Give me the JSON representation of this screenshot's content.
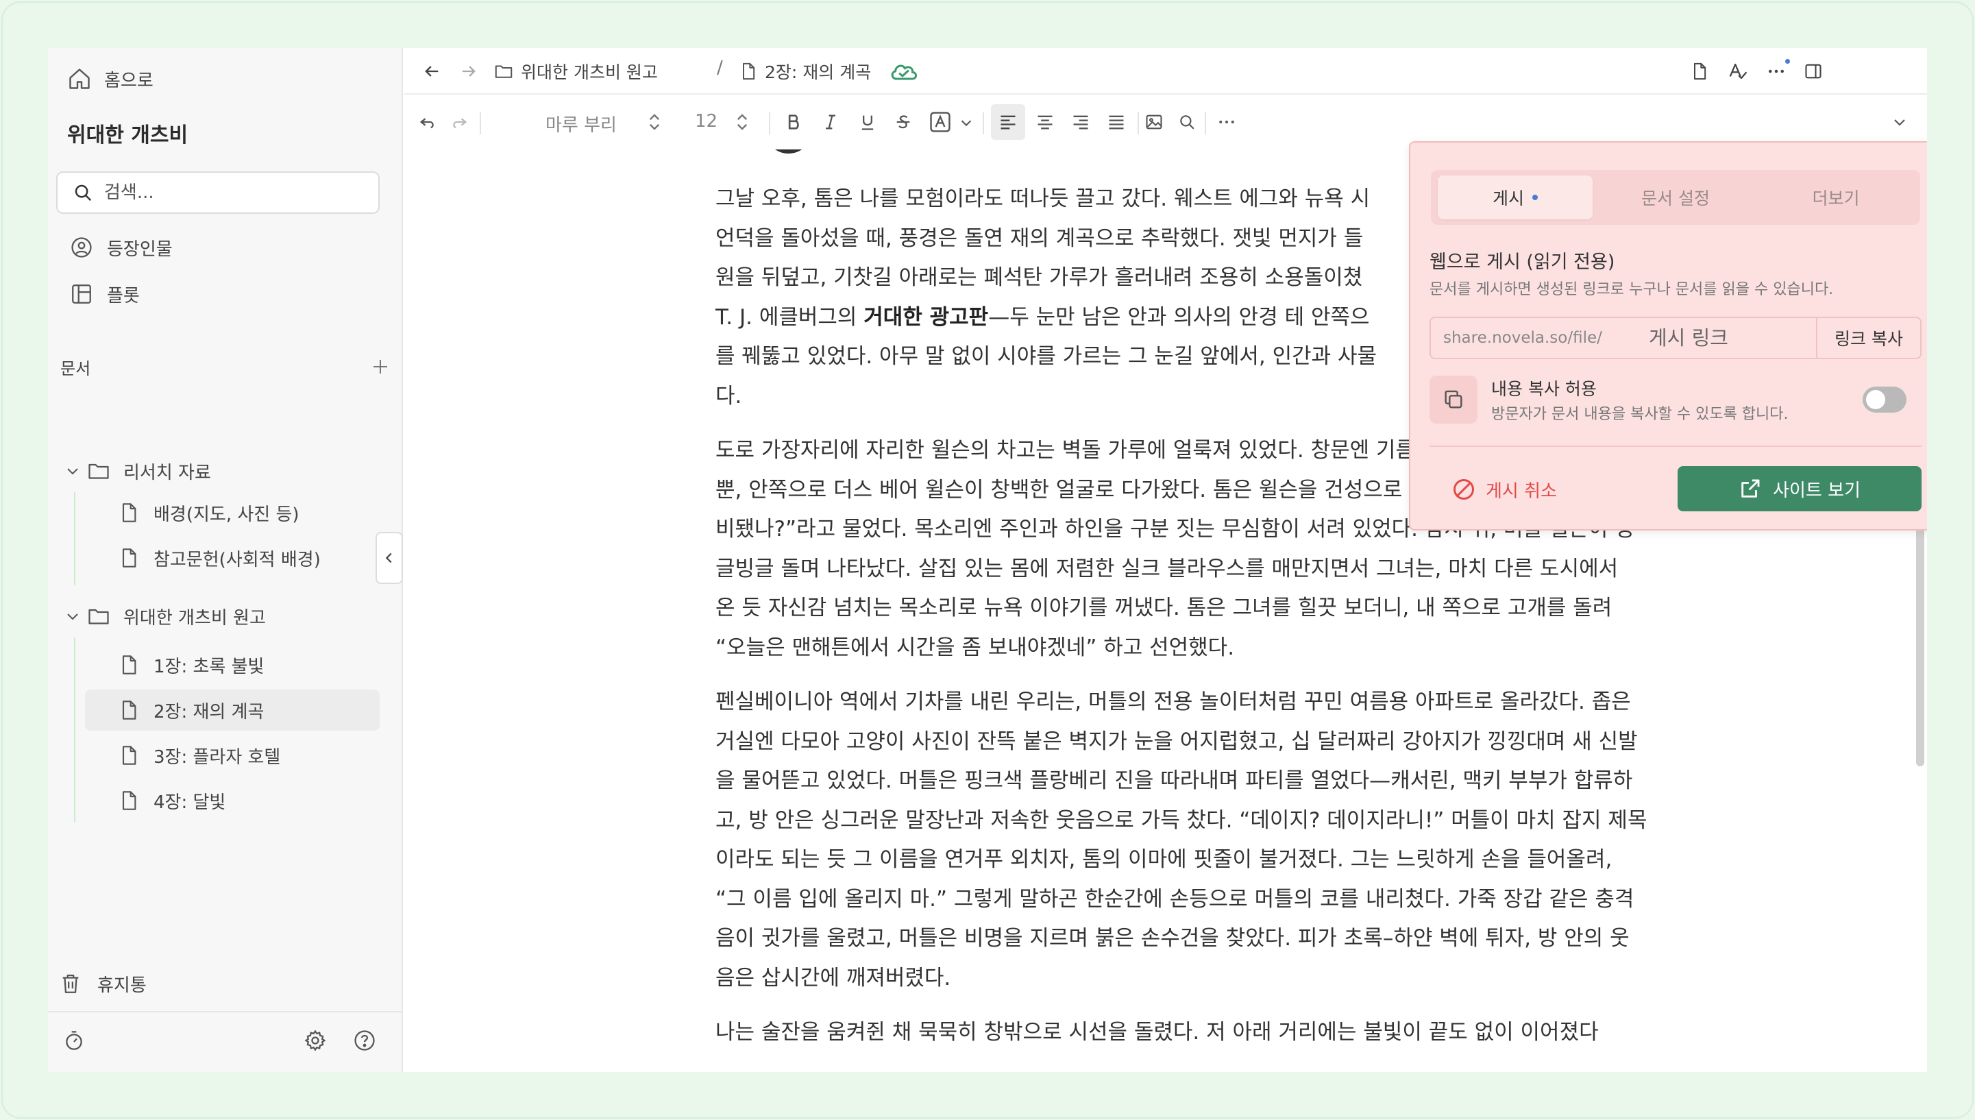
{
  "sidebar": {
    "home": "홈으로",
    "project_title": "위대한 개츠비",
    "search_placeholder": "검색...",
    "nav": {
      "characters": "등장인물",
      "plot": "플롯"
    },
    "docs_section": "문서",
    "folders": [
      {
        "label": "리서치 자료",
        "files": [
          "배경(지도, 사진 등)",
          "참고문헌(사회적 배경)"
        ]
      },
      {
        "label": "위대한 개츠비 원고",
        "files": [
          "1장: 초록 불빛",
          "2장: 재의 계곡",
          "3장: 플라자 호텔",
          "4장: 달빛"
        ]
      }
    ],
    "trash": "휴지통"
  },
  "header": {
    "breadcrumb": [
      "위대한 개츠비 원고",
      "2장: 재의 계곡"
    ],
    "separator": "/",
    "sync_status": "saved"
  },
  "toolbar": {
    "font": "마루 부리",
    "size": "12",
    "more": "···"
  },
  "content": {
    "p1_a": "그날 오후, 톰은 나를 모험이라도 떠나듯 끌고 갔다. 웨스트 에그와 뉴욕 시",
    "p1_b": "언덕을 돌아섰을 때, 풍경은 돌연 재의 계곡으로 추락했다. 잿빛 먼지가 들",
    "p1_c": "원을 뒤덮고, 기찻길 아래로는 폐석탄 가루가 흘러내려 조용히 소용돌이쳤",
    "p1_d_pre": "T. J. 에클버그의 ",
    "p1_d_bold": "거대한 광고판",
    "p1_d_post": "—두 눈만 남은 안과 의사의 안경 테 안쪽으",
    "p1_e": "를 꿰뚫고 있었다. 아무 말 없이 시야를 가르는 그 눈길 앞에서, 인간과 사물",
    "p1_f": "다.",
    "p2_a": "도로 가장자리에 자리한 윌슨의 차고는 벽돌 가루에 얼룩져 있었다. 창문엔 기름때 낀 유리조각이 몇 개",
    "p2_b": "뿐, 안쪽으로 더스 베어 윌슨이 창백한 얼굴로 다가왔다. 톰은 윌슨을 건성으로 불러 세우고는, “그 차 준",
    "p2_c": "비됐나?”라고 물었다. 목소리엔 주인과 하인을 구분 짓는 무심함이 서려 있었다. 잠시 뒤, 머틀 윌슨이 빙",
    "p2_d": "글빙글 돌며 나타났다. 살집 있는 몸에 저렴한 실크 블라우스를 매만지면서 그녀는, 마치 다른 도시에서",
    "p2_e": "온 듯 자신감 넘치는 목소리로 뉴욕 이야기를 꺼냈다. 톰은 그녀를 힐끗 보더니, 내 쪽으로 고개를 돌려",
    "p2_f": "“오늘은 맨해튼에서 시간을 좀 보내야겠네” 하고 선언했다.",
    "p3_a": "펜실베이니아 역에서 기차를 내린 우리는, 머틀의 전용 놀이터처럼 꾸민 여름용 아파트로 올라갔다. 좁은",
    "p3_b": "거실엔 다모아 고양이 사진이 잔뜩 붙은 벽지가 눈을 어지럽혔고, 십 달러짜리 강아지가 낑낑대며 새 신발",
    "p3_c": "을 물어뜯고 있었다. 머틀은 핑크색 플랑베리 진을 따라내며 파티를 열었다—캐서린, 맥키 부부가 합류하",
    "p3_d": "고, 방 안은 싱그러운 말장난과 저속한 웃음으로 가득 찼다. “데이지? 데이지라니!” 머틀이 마치 잡지 제목",
    "p3_e": "이라도 되는 듯 그 이름을 연거푸 외치자, 톰의 이마에 핏줄이 불거졌다. 그는 느릿하게 손을 들어올려,",
    "p3_f": "“그 이름 입에 올리지 마.” 그렇게 말하곤 한순간에 손등으로 머틀의 코를 내리쳤다. 가죽 장갑 같은 충격",
    "p3_g": "음이 귓가를 울렸고, 머틀은 비명을 지르며 붉은 손수건을 찾았다. 피가 초록–하얀 벽에 튀자, 방 안의 웃",
    "p3_h": "음은 삽시간에 깨져버렸다.",
    "p4_cut": "나는 술잔을 움켜쥔 채 묵묵히 창밖으로 시선을 돌렸다. 저 아래 거리에는 불빛이 끝도 없이 이어졌다"
  },
  "popover": {
    "tabs": [
      "게시",
      "문서 설정",
      "더보기"
    ],
    "publish_title": "웹으로 게시 (읽기 전용)",
    "publish_desc": "문서를 게시하면 생성된 링크로 누구나 문서를 읽을 수 있습니다.",
    "link_prefix": "share.novela.so/file/",
    "link_placeholder": "게시 링크",
    "copy_link": "링크 복사",
    "perm_title": "내용 복사 허용",
    "perm_desc": "방문자가 문서 내용을 복사할 수 있도록 합니다.",
    "copy_allowed": false,
    "unpublish": "게시 취소",
    "visit_site": "사이트 보기"
  },
  "colors": {
    "background": "#e9f8ea",
    "accent_green": "#3e8a66",
    "danger_red": "#e24a4a",
    "popover_bg": "#fde1e1"
  }
}
